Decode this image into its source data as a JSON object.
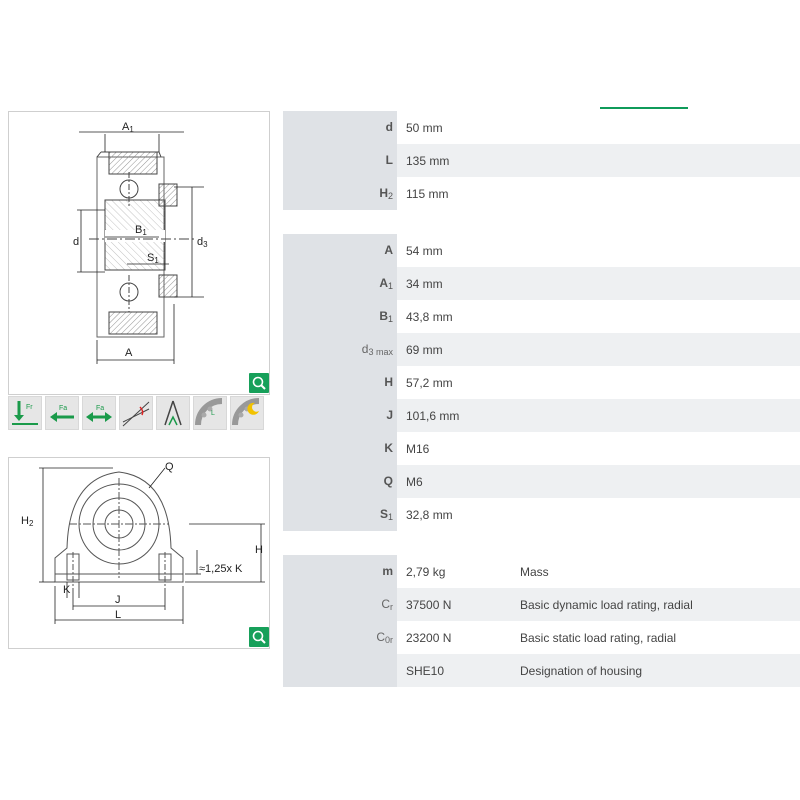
{
  "colors": {
    "accent": "#0f9b5a",
    "zoom_button": "#17a05a",
    "row_shade": "#eef0f2",
    "label_column": "#dfe2e6"
  },
  "drawing1": {
    "labels": {
      "A1": "A",
      "A1_sub": "1",
      "B1": "B",
      "B1_sub": "1",
      "S1": "S",
      "S1_sub": "1",
      "d": "d",
      "d3": "d",
      "d3_sub": "3",
      "A": "A"
    }
  },
  "drawing2": {
    "labels": {
      "Q": "Q",
      "H2": "H",
      "H2_sub": "2",
      "H": "H",
      "K_note": "≈1,25x K",
      "K": "K",
      "J": "J",
      "L": "L"
    }
  },
  "icons": [
    "radial-load-icon",
    "axial-load-icon",
    "bidirectional-axial-load-icon",
    "misalignment-icon",
    "angular-adjust-icon",
    "lubrication-icon",
    "low-speed-icon"
  ],
  "icon_labels": [
    "Fr",
    "Fa",
    "Fa"
  ],
  "table1": [
    {
      "label": "d",
      "sub": "",
      "value": "50  mm"
    },
    {
      "label": "L",
      "sub": "",
      "value": "135  mm"
    },
    {
      "label": "H",
      "sub": "2",
      "value": "115  mm"
    }
  ],
  "table2": [
    {
      "label": "A",
      "sub": "",
      "value": "54  mm"
    },
    {
      "label": "A",
      "sub": "1",
      "value": "34  mm"
    },
    {
      "label": "B",
      "sub": "1",
      "value": "43,8  mm"
    },
    {
      "label": "d",
      "sub": "3 max",
      "value": "69  mm"
    },
    {
      "label": "H",
      "sub": "",
      "value": "57,2  mm"
    },
    {
      "label": "J",
      "sub": "",
      "value": "101,6  mm"
    },
    {
      "label": "K",
      "sub": "",
      "value": "M16"
    },
    {
      "label": "Q",
      "sub": "",
      "value": "M6"
    },
    {
      "label": "S",
      "sub": "1",
      "value": "32,8  mm"
    }
  ],
  "table3": [
    {
      "label": "m",
      "sub": "",
      "value": "2,79  kg",
      "desc": "Mass"
    },
    {
      "label": "C",
      "sub": "r",
      "value": "37500  N",
      "desc": "Basic dynamic load rating, radial"
    },
    {
      "label": "C",
      "sub": "0r",
      "value": "23200  N",
      "desc": "Basic static load rating, radial"
    },
    {
      "label": "",
      "sub": "",
      "value": "SHE10",
      "desc": "Designation of housing"
    }
  ]
}
